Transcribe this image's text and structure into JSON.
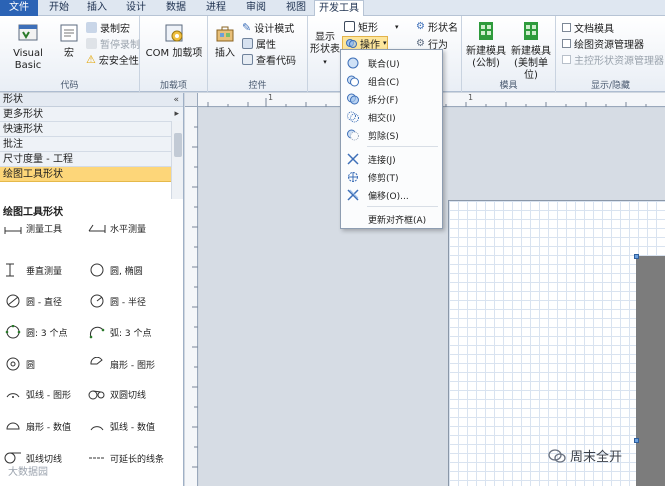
{
  "tabs": [
    "文件",
    "开始",
    "插入",
    "设计",
    "数据",
    "进程",
    "审阅",
    "视图",
    "开发工具"
  ],
  "active_tab": "开发工具",
  "groups": {
    "code": {
      "label": "代码",
      "visual_basic": "Visual Basic",
      "macro": "宏",
      "record_macro": "录制宏",
      "pause_recording": "暂停录制",
      "macro_security": "宏安全性"
    },
    "addins": {
      "label": "加载项",
      "com_addins": "COM 加载项"
    },
    "controls": {
      "label": "控件",
      "insert": "插入",
      "design_mode": "设计模式",
      "properties": "属性",
      "view_code": "查看代码"
    },
    "shape_design": {
      "show_shapesheet": "显示",
      "shapesheet_line2": "形状表",
      "rectangle": "矩形",
      "operations": "操作",
      "shape_name": "形状名",
      "behavior": "行为"
    },
    "stencil": {
      "label": "模具",
      "new_stencil_us": "新建模具",
      "new_stencil_us_sub": "(公制)",
      "new_stencil_metric": "新建模具",
      "new_stencil_metric_sub": "(美制单位)"
    },
    "show_hide": {
      "label": "显示/隐藏",
      "document_stencil": "文档模具",
      "drawing_explorer": "绘图资源管理器",
      "master_explorer": "主控形状资源管理器"
    }
  },
  "operations_menu": {
    "items": [
      {
        "label": "联合(U)",
        "icon": "union-icon"
      },
      {
        "label": "组合(C)",
        "icon": "combine-icon"
      },
      {
        "label": "拆分(F)",
        "icon": "fragment-icon"
      },
      {
        "label": "相交(I)",
        "icon": "intersect-icon"
      },
      {
        "label": "剪除(S)",
        "icon": "subtract-icon"
      },
      {
        "label": "连接(J)",
        "icon": "join-icon"
      },
      {
        "label": "修剪(T)",
        "icon": "trim-icon"
      },
      {
        "label": "偏移(O)...",
        "icon": "offset-icon"
      },
      {
        "label": "更新对齐框(A)",
        "icon": ""
      }
    ]
  },
  "shapes_pane": {
    "title": "形状",
    "more_shapes": "更多形状",
    "categories": [
      "快速形状",
      "批注",
      "尺寸度量 - 工程",
      "绘图工具形状"
    ],
    "selected_category": "绘图工具形状",
    "stencil_title": "绘图工具形状",
    "shapes": [
      "测量工具",
      "水平测量",
      "垂直测量",
      "圆, 椭圆",
      "圆 - 直径",
      "圆 - 半径",
      "圆: 3 个点",
      "弧: 3 个点",
      "圆",
      "扇形 - 图形",
      "弧线 - 图形",
      "双圆切线",
      "扇形 - 数值",
      "弧线 - 数值",
      "弧线切线",
      "可延长的线条"
    ]
  },
  "ruler": {
    "ticks": [
      "1",
      "1"
    ]
  },
  "watermark": {
    "name": "周末全开",
    "logo_text": "大数据园"
  }
}
